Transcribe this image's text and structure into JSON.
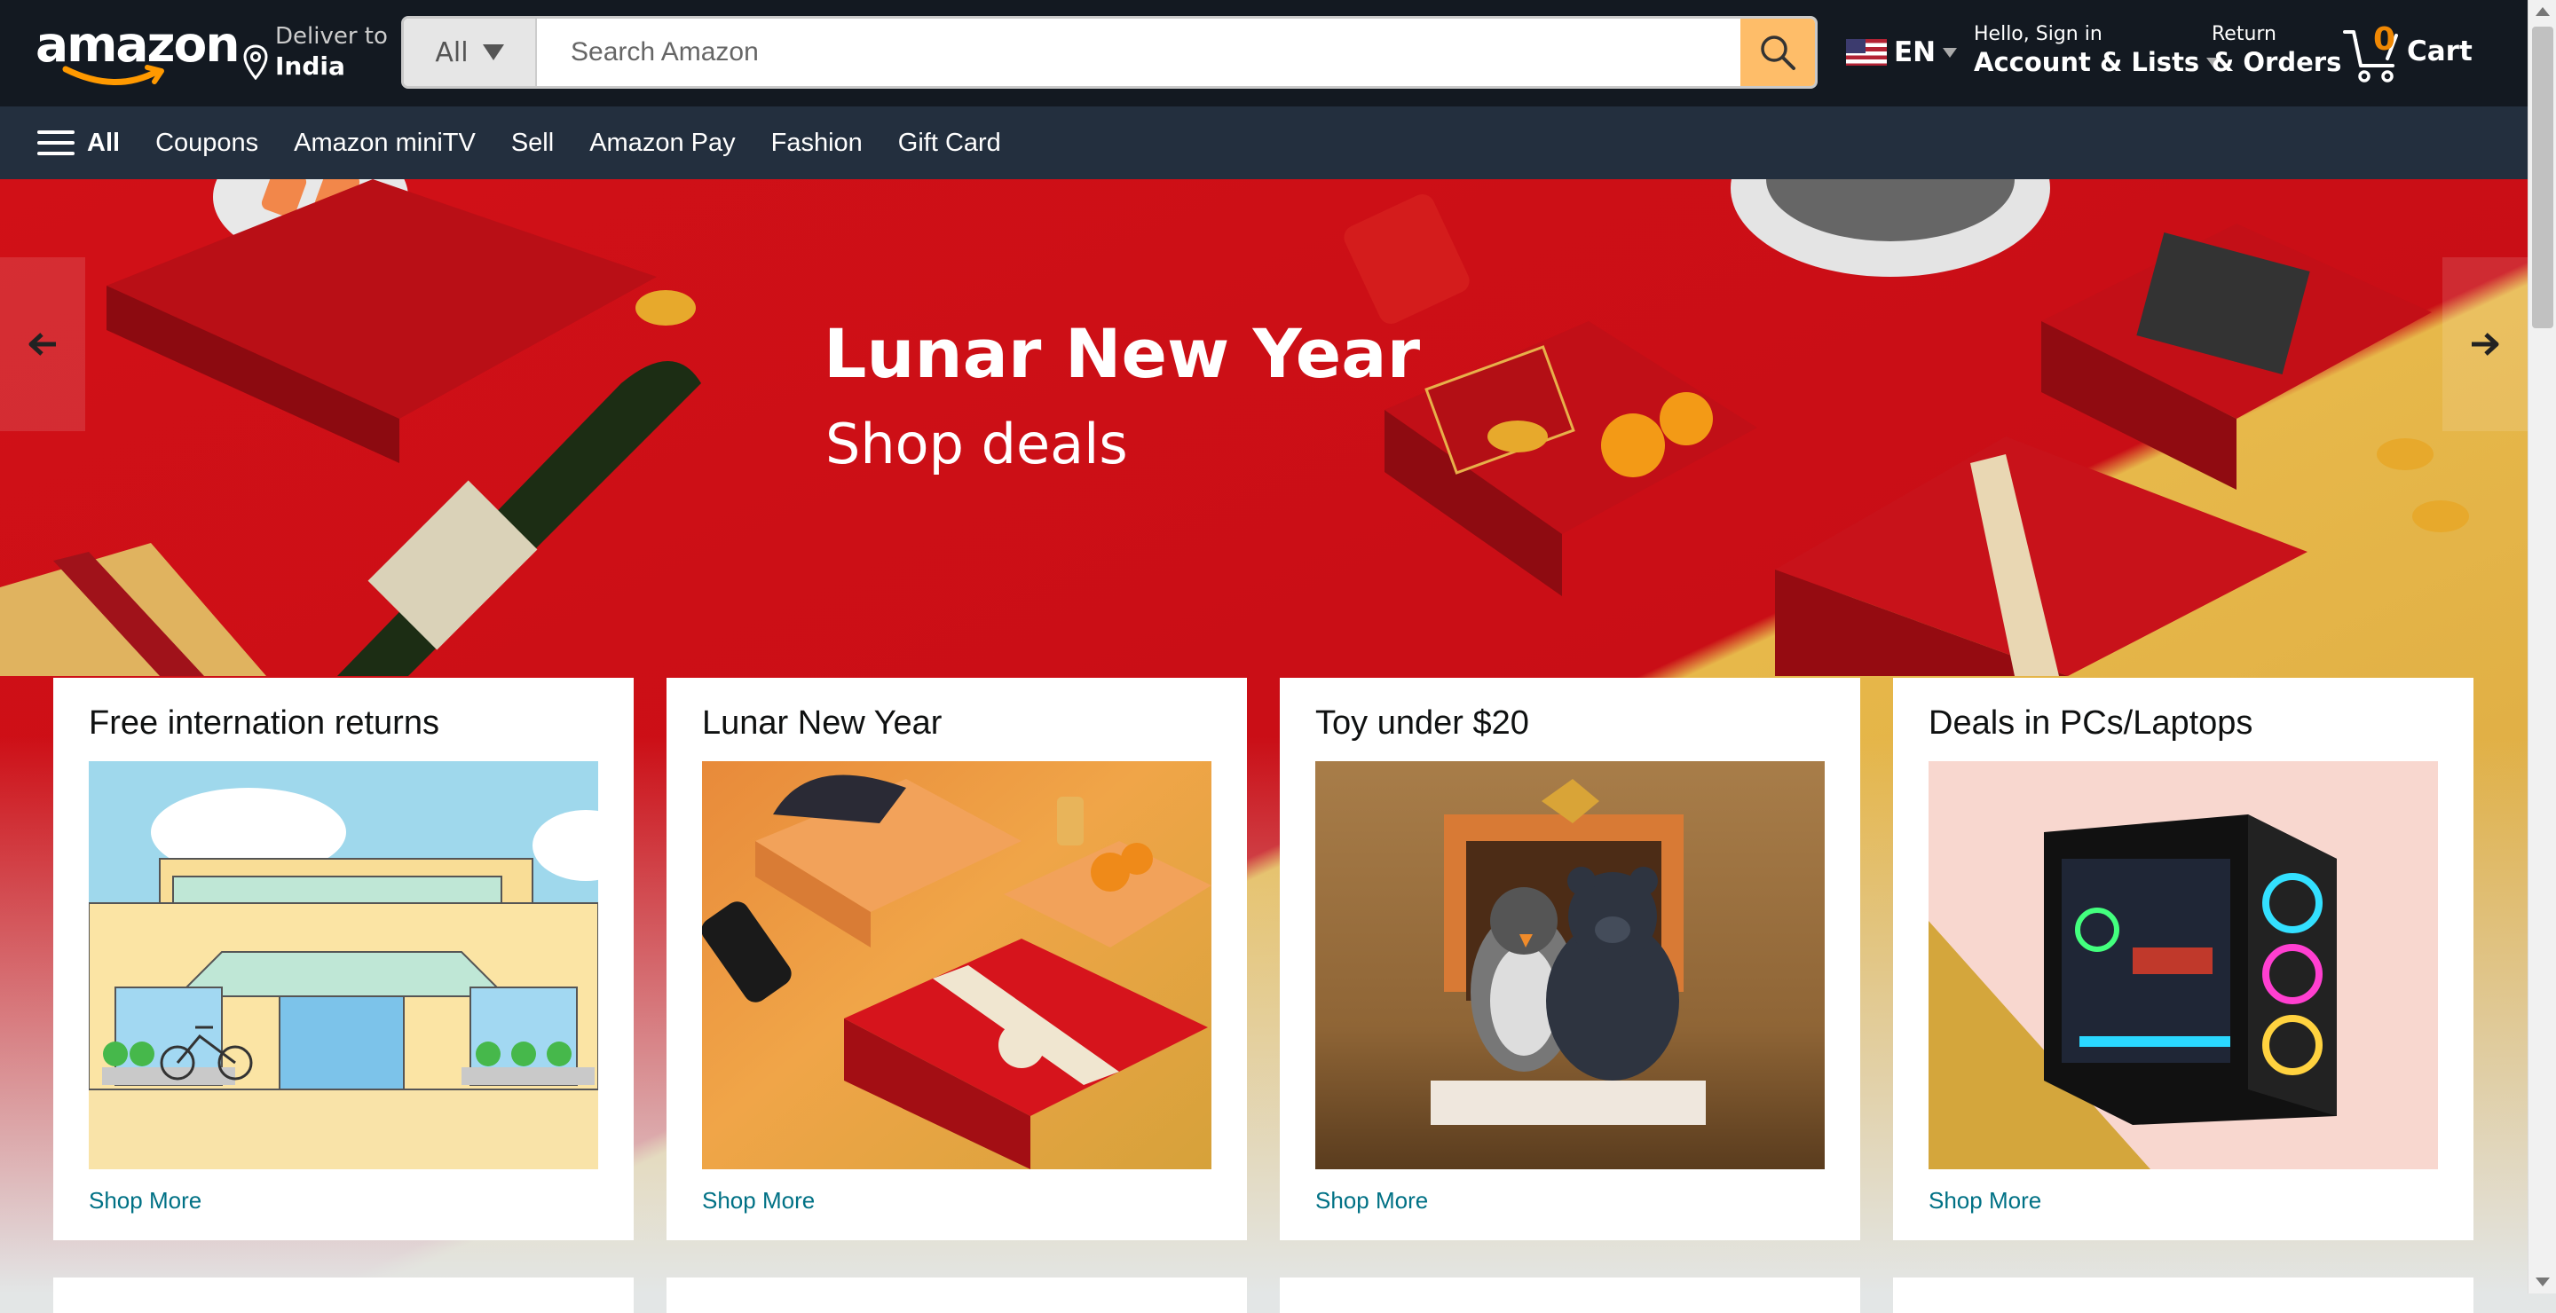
{
  "header": {
    "logo_text": "amazon",
    "deliver": {
      "line1": "Deliver to",
      "line2": "India"
    },
    "search": {
      "category": "All",
      "placeholder": "Search Amazon"
    },
    "lang": {
      "code": "EN"
    },
    "account": {
      "line1": "Hello, Sign in",
      "line2": "Account & Lists"
    },
    "returns": {
      "line1": "Return",
      "line2": "& Orders"
    },
    "cart": {
      "count": "0",
      "label": "Cart"
    }
  },
  "subnav": {
    "all": "All",
    "items": [
      "Coupons",
      "Amazon miniTV",
      "Sell",
      "Amazon Pay",
      "Fashion",
      "Gift Card"
    ]
  },
  "hero": {
    "title": "Lunar New Year",
    "subtitle": "Shop deals"
  },
  "cards": [
    {
      "title": "Free internation returns",
      "link": "Shop More"
    },
    {
      "title": "Lunar New Year",
      "link": "Shop More"
    },
    {
      "title": "Toy under $20",
      "link": "Shop More"
    },
    {
      "title": "Deals in PCs/Laptops",
      "link": "Shop More"
    }
  ],
  "colors": {
    "header_bg": "#131921",
    "subnav_bg": "#232f3e",
    "search_btn": "#febd69",
    "link": "#007185",
    "cart_count": "#f08804"
  }
}
